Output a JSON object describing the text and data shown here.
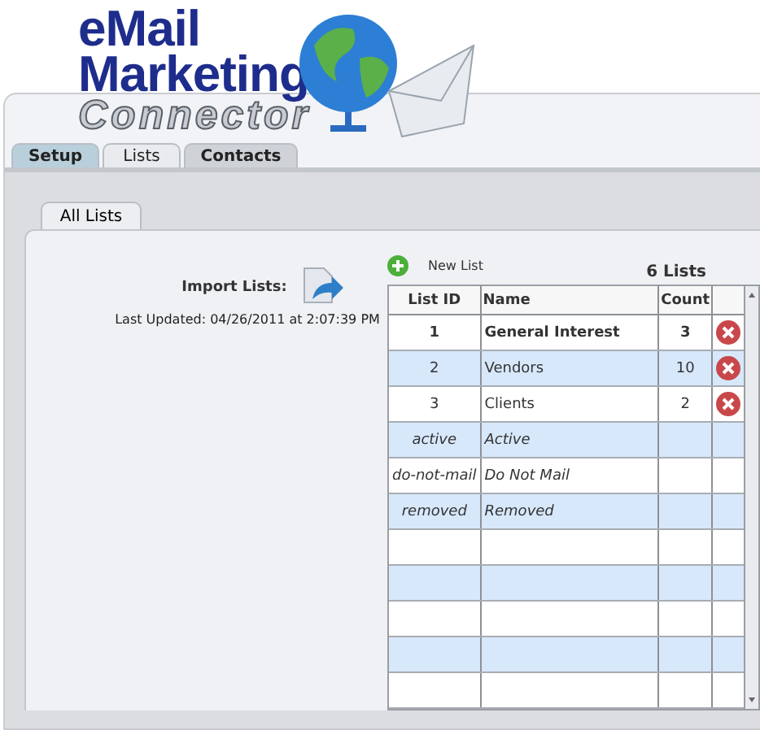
{
  "logo": {
    "line_1": "eMail",
    "line_2": "Marketing",
    "line_3": "Connector"
  },
  "tabs": [
    {
      "label": "Setup",
      "selected": false,
      "kind": "setup"
    },
    {
      "label": "Lists",
      "selected": true,
      "kind": "plain"
    },
    {
      "label": "Contacts",
      "selected": false,
      "kind": "plain"
    }
  ],
  "subtabs": [
    {
      "label": "All Lists",
      "selected": true
    }
  ],
  "import": {
    "label": "Import Lists:",
    "last_updated": "Last Updated:  04/26/2011 at 2:07:39 PM"
  },
  "new_list": "New List",
  "list_count": "6 Lists",
  "table": {
    "columns": [
      "List ID",
      "Name",
      "Count"
    ],
    "rows": [
      {
        "kind": "default",
        "id": "1",
        "name": "General Interest",
        "count": "3"
      },
      {
        "kind": "custom",
        "id": "2",
        "name": "Vendors",
        "count": "10"
      },
      {
        "kind": "custom",
        "id": "3",
        "name": "Clients",
        "count": "2"
      },
      {
        "kind": "system",
        "id": "active",
        "name": "Active"
      },
      {
        "kind": "system",
        "id": "do-not-mail",
        "name": "Do Not Mail"
      },
      {
        "kind": "system",
        "id": "removed",
        "name": "Removed"
      },
      {
        "kind": "empty"
      },
      {
        "kind": "empty"
      },
      {
        "kind": "empty"
      },
      {
        "kind": "empty"
      },
      {
        "kind": "empty"
      }
    ]
  }
}
